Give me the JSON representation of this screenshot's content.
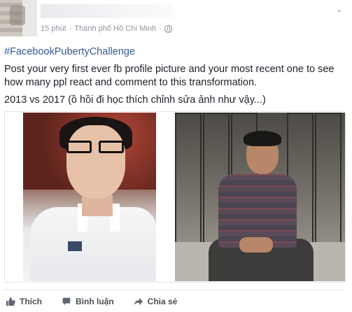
{
  "post": {
    "meta": {
      "time": "15 phút",
      "separator": "·",
      "location": "Thành phố Hồ Chí Minh",
      "separator2": "·"
    },
    "hashtag": "#FacebookPubertyChallenge",
    "body": [
      "Post your very first ever fb profile picture and your most recent one to see how many ppl react and comment to this transformation.",
      "2013 vs 2017 (ồ hồi đi học thích chỉnh sửa ảnh như vậy...)"
    ],
    "icons": {
      "privacy": "globe-icon",
      "options": "chevron-down-icon"
    }
  },
  "actions": {
    "like": "Thích",
    "comment": "Bình luận",
    "share": "Chia sẻ"
  }
}
